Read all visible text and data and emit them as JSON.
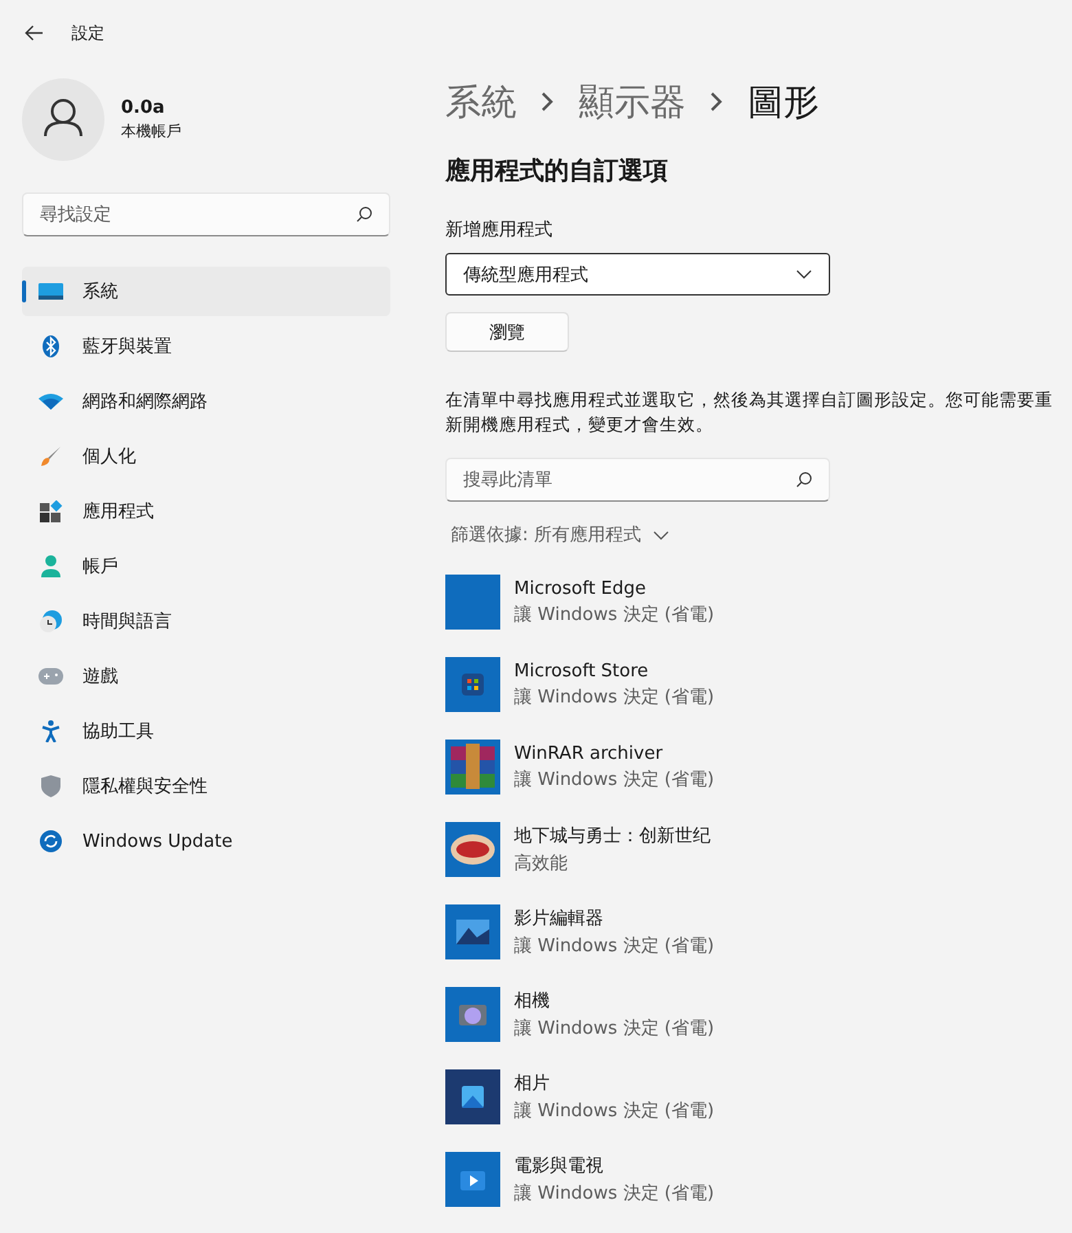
{
  "window": {
    "title": "設定"
  },
  "account": {
    "name": "0.0a",
    "type": "本機帳戶"
  },
  "sidebar": {
    "search": {
      "placeholder": "尋找設定"
    },
    "items": [
      {
        "label": "系統",
        "selected": true
      },
      {
        "label": "藍牙與裝置",
        "selected": false
      },
      {
        "label": "網路和網際網路",
        "selected": false
      },
      {
        "label": "個人化",
        "selected": false
      },
      {
        "label": "應用程式",
        "selected": false
      },
      {
        "label": "帳戶",
        "selected": false
      },
      {
        "label": "時間與語言",
        "selected": false
      },
      {
        "label": "遊戲",
        "selected": false
      },
      {
        "label": "協助工具",
        "selected": false
      },
      {
        "label": "隱私權與安全性",
        "selected": false
      },
      {
        "label": "Windows Update",
        "selected": false
      }
    ]
  },
  "breadcrumb": [
    "系統",
    "顯示器",
    "圖形"
  ],
  "section_title": "應用程式的自訂選項",
  "add_app": {
    "label": "新增應用程式",
    "value": "傳統型應用程式",
    "browse_button": "瀏覽"
  },
  "description": "在清單中尋找應用程式並選取它，然後為其選擇自訂圖形設定。您可能需要重新開機應用程式，變更才會生效。",
  "list_search": {
    "placeholder": "搜尋此清單"
  },
  "filter": {
    "label": "篩選依據:",
    "value": "所有應用程式"
  },
  "apps": [
    {
      "name": "Microsoft Edge",
      "setting": "讓 Windows 決定 (省電)"
    },
    {
      "name": "Microsoft Store",
      "setting": "讓 Windows 決定 (省電)"
    },
    {
      "name": "WinRAR archiver",
      "setting": "讓 Windows 決定 (省電)"
    },
    {
      "name": "地下城与勇士：创新世纪",
      "setting": "高效能"
    },
    {
      "name": "影片編輯器",
      "setting": "讓 Windows 決定 (省電)"
    },
    {
      "name": "相機",
      "setting": "讓 Windows 決定 (省電)"
    },
    {
      "name": "相片",
      "setting": "讓 Windows 決定 (省電)"
    },
    {
      "name": "電影與電視",
      "setting": "讓 Windows 決定 (省電)"
    }
  ]
}
